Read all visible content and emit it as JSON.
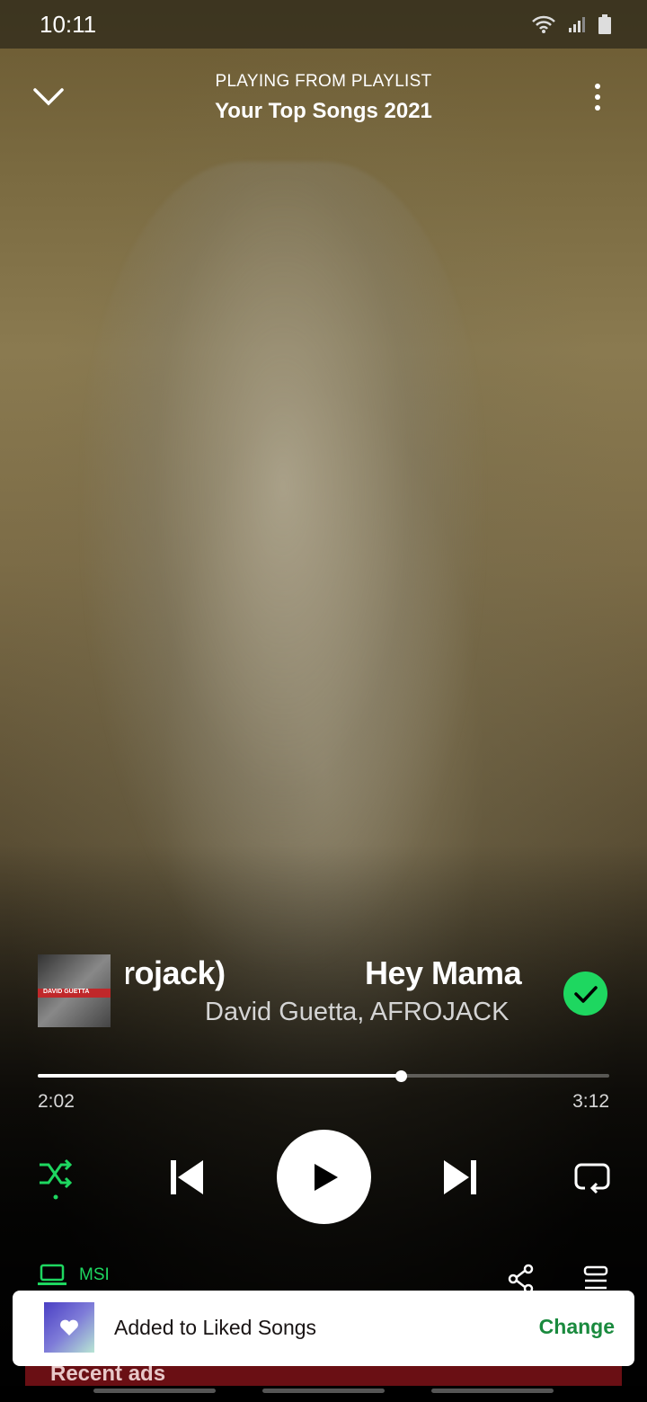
{
  "status_bar": {
    "time": "10:11"
  },
  "header": {
    "context_label": "PLAYING FROM PLAYLIST",
    "context_title": "Your Top Songs 2021"
  },
  "track": {
    "title_tail": "rojack)",
    "title_head": "Hey Mama",
    "artists": "David Guetta, AFROJACK",
    "cover_text": "DAVID GUETTA",
    "liked": true
  },
  "progress": {
    "elapsed": "2:02",
    "total": "3:12",
    "fraction": 0.635
  },
  "device": {
    "name": "MSI"
  },
  "ad_strip": {
    "text": "Recent ads"
  },
  "toast": {
    "message": "Added to Liked Songs",
    "action": "Change"
  },
  "colors": {
    "accent": "#1ed760",
    "toast_action": "#1a8a3e"
  },
  "icons": [
    "chevron-down-icon",
    "more-vertical-icon",
    "check-icon",
    "shuffle-icon",
    "skip-previous-icon",
    "play-icon",
    "skip-next-icon",
    "repeat-icon",
    "laptop-icon",
    "share-icon",
    "queue-icon",
    "heart-icon",
    "wifi-icon",
    "signal-icon",
    "battery-icon"
  ]
}
